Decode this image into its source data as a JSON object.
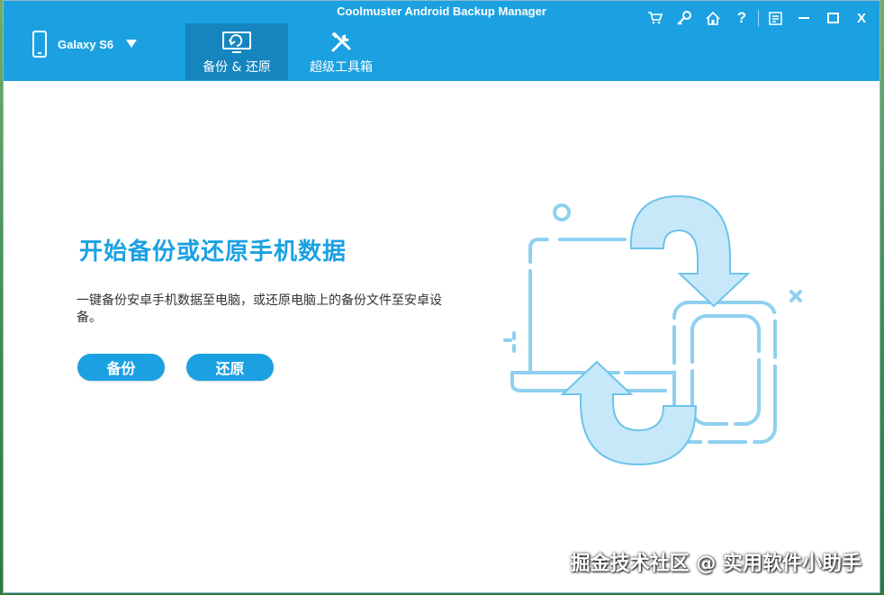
{
  "window": {
    "title": "Coolmuster Android Backup Manager"
  },
  "device": {
    "name": "Galaxy S6"
  },
  "nav": {
    "tabs": [
      {
        "label": "备份 & 还原",
        "active": true
      },
      {
        "label": "超级工具箱",
        "active": false
      }
    ]
  },
  "toolbar_icons": [
    "cart-icon",
    "key-icon",
    "home-icon",
    "help-icon",
    "feedback-icon",
    "minimize-icon",
    "maximize-icon",
    "close-icon"
  ],
  "toolbar_labels": {
    "help": "?",
    "close": "X"
  },
  "main": {
    "heading": "开始备份或还原手机数据",
    "description": "一键备份安卓手机数据至电脑，或还原电脑上的备份文件至安卓设备。",
    "backup_button": "备份",
    "restore_button": "还原"
  },
  "watermark": "掘金技术社区 @ 实用软件小助手",
  "colors": {
    "accent": "#1ba1e2",
    "active_tab": "#1585c0",
    "illustration": "#8fd0f0"
  }
}
